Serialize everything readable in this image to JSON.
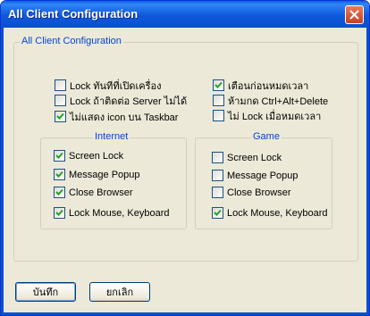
{
  "window": {
    "title": "All Client Configuration"
  },
  "main_group": {
    "title": "All Client Configuration"
  },
  "options_left": [
    {
      "label": "Lock ทันทีที่เปิดเครื่อง",
      "checked": false
    },
    {
      "label": "Lock ถ้าติดต่อ Server ไม่ได้",
      "checked": false
    },
    {
      "label": "ไม่แสดง icon บน Taskbar",
      "checked": true
    }
  ],
  "options_right": [
    {
      "label": "เตือนก่อนหมดเวลา",
      "checked": true
    },
    {
      "label": "ห้ามกด Ctrl+Alt+Delete",
      "checked": false
    },
    {
      "label": "ไม่ Lock เมื่อหมดเวลา",
      "checked": false
    }
  ],
  "internet": {
    "title": "Internet",
    "items": [
      {
        "label": "Screen Lock",
        "checked": true
      },
      {
        "label": "Message Popup",
        "checked": true
      },
      {
        "label": "Close Browser",
        "checked": true
      },
      {
        "label": "Lock Mouse, Keyboard",
        "checked": true
      }
    ]
  },
  "game": {
    "title": "Game",
    "items": [
      {
        "label": "Screen Lock",
        "checked": false
      },
      {
        "label": "Message Popup",
        "checked": false
      },
      {
        "label": "Close Browser",
        "checked": false
      },
      {
        "label": "Lock Mouse, Keyboard",
        "checked": true
      }
    ]
  },
  "buttons": {
    "save": "บันทึก",
    "cancel": "ยกเลิก"
  }
}
